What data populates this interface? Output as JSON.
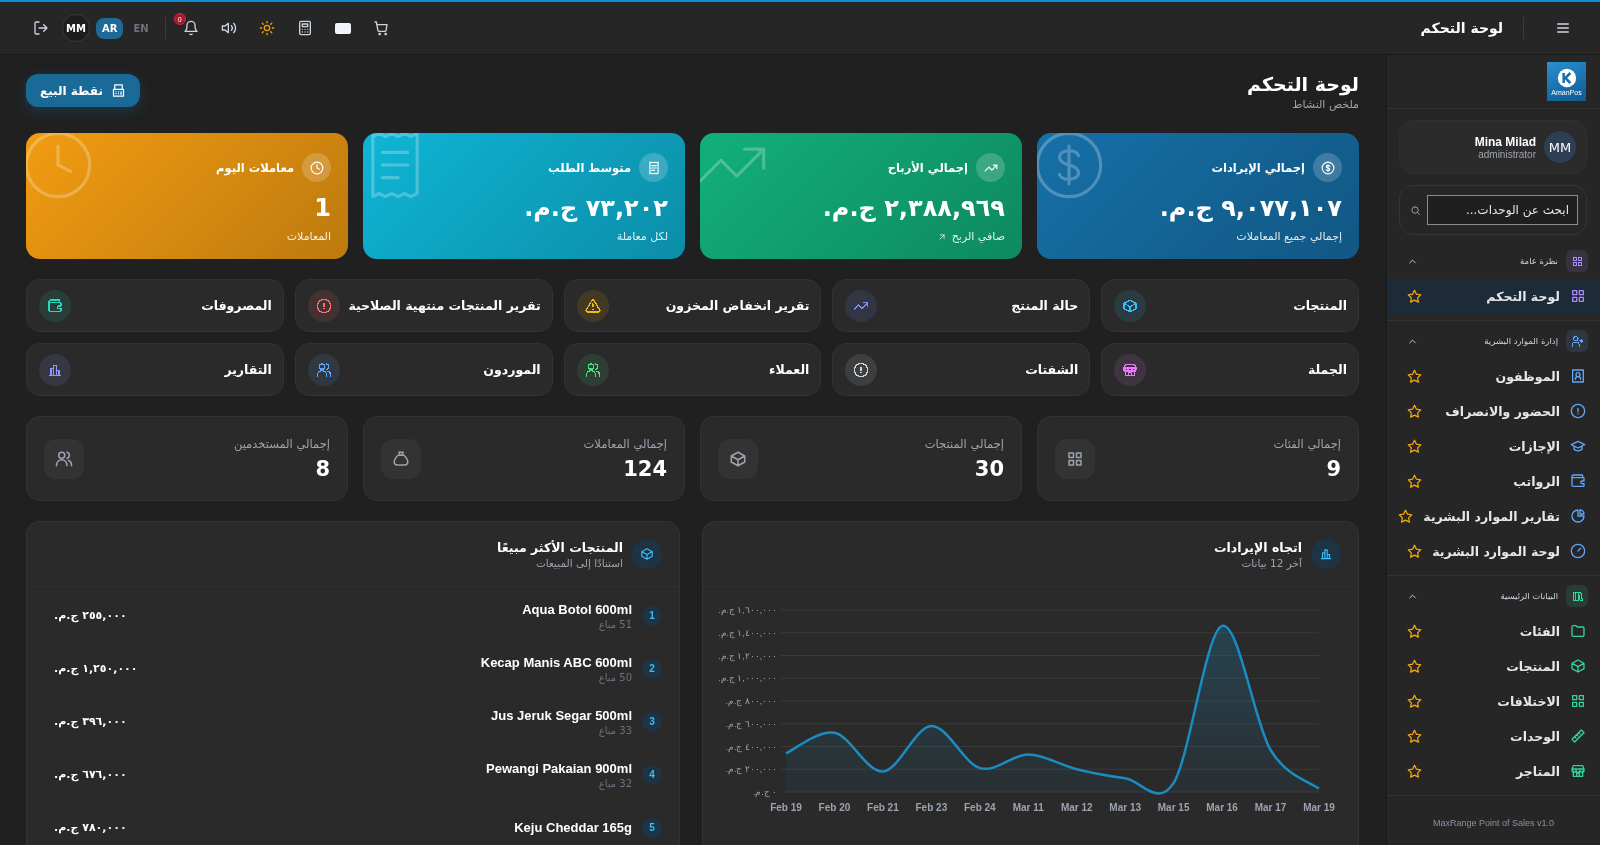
{
  "topbar": {
    "title": "لوحة التحكم",
    "user_initials": "MM",
    "languages": [
      {
        "label": "EN",
        "selected": false
      },
      {
        "label": "AR",
        "selected": true
      }
    ],
    "notification_count": "0"
  },
  "sidebar": {
    "logo_text": "AmanPos",
    "user": {
      "name": "Mina Milad",
      "role": "administrator",
      "initials": "MM"
    },
    "search": {
      "placeholder": "ابحث عن الوحدات..."
    },
    "groups": [
      {
        "title": "نظرة عامة",
        "expanded": true,
        "color": "#a78bfa",
        "items": [
          {
            "label": "لوحة التحكم",
            "selected": true
          }
        ]
      },
      {
        "title": "إدارة الموارد البشرية",
        "expanded": true,
        "color": "#60a5fa",
        "items": [
          {
            "label": "الموظفون",
            "selected": false
          },
          {
            "label": "الحضور والانصراف",
            "selected": false
          },
          {
            "label": "الإجازات",
            "selected": false
          },
          {
            "label": "الرواتب",
            "selected": false
          },
          {
            "label": "تقارير الموارد البشرية",
            "selected": false
          },
          {
            "label": "لوحة الموارد البشرية",
            "selected": false
          }
        ]
      },
      {
        "title": "البيانات الرئيسية",
        "expanded": true,
        "color": "#34d399",
        "items": [
          {
            "label": "الفئات",
            "selected": false
          },
          {
            "label": "المنتجات",
            "selected": false
          },
          {
            "label": "الاختلافات",
            "selected": false
          },
          {
            "label": "الوحدات",
            "selected": false
          },
          {
            "label": "المتاجر",
            "selected": false
          }
        ]
      }
    ],
    "footer": "MaxRange Point of Sales v1.0"
  },
  "page": {
    "title": "لوحة التحكم",
    "subtitle": "ملخص النشاط",
    "pos_button": "نقطة البيع"
  },
  "stat_cards": [
    {
      "label": "إجمالي الإيرادات",
      "value": "٩,٠٧٧,١٠٧ ج.م.",
      "note": "إجمالي جميع المعاملات",
      "color": "#1670a8"
    },
    {
      "label": "إجمالي الأرباح",
      "value": "٢,٣٨٨,٩٦٩ ج.م.",
      "note": "صافي الربح",
      "color": "#12b07a"
    },
    {
      "label": "متوسط الطلب",
      "value": "٧٣,٢٠٢ ج.م.",
      "note": "لكل معاملة",
      "color": "#0fb5d6"
    },
    {
      "label": "معاملات اليوم",
      "value": "1",
      "note": "المعاملات",
      "color": "#f29c12"
    }
  ],
  "quick_links": [
    {
      "label": "المنتجات",
      "color": "#38bdf8"
    },
    {
      "label": "حالة المنتج",
      "color": "#818cf8"
    },
    {
      "label": "تقرير انخفاض المخزون",
      "color": "#f5b50b"
    },
    {
      "label": "تقرير المنتجات منتهية الصلاحية",
      "color": "#f87171"
    },
    {
      "label": "المصروفات",
      "color": "#2dd4bf"
    },
    {
      "label": "الجملة",
      "color": "#e879f9"
    },
    {
      "label": "الشفتات",
      "color": "#d1d5db"
    },
    {
      "label": "العملاء",
      "color": "#4ade80"
    },
    {
      "label": "الموردون",
      "color": "#60a5fa"
    },
    {
      "label": "التقارير",
      "color": "#8b9cf8"
    }
  ],
  "counts": [
    {
      "label": "إجمالي الفئات",
      "value": "9"
    },
    {
      "label": "إجمالي المنتجات",
      "value": "30"
    },
    {
      "label": "إجمالي المعاملات",
      "value": "124"
    },
    {
      "label": "إجمالي المستخدمين",
      "value": "8"
    }
  ],
  "revenue_trend": {
    "title": "اتجاه الإيرادات",
    "subtitle": "آخر 12 بيانات",
    "chart_data": {
      "type": "area",
      "categories": [
        "Feb 19",
        "Feb 20",
        "Feb 21",
        "Feb 23",
        "Feb 24",
        "Mar 11",
        "Mar 12",
        "Mar 13",
        "Mar 15",
        "Mar 16",
        "Mar 17",
        "Mar 19"
      ],
      "series": [
        {
          "color": "#1a8cc2",
          "values": [
            340000,
            520000,
            180000,
            580000,
            210000,
            330000,
            200000,
            120000,
            80000,
            1460000,
            370000,
            30000
          ]
        }
      ],
      "grid": true,
      "ylim": [
        0,
        1600000
      ],
      "yticks": [
        {
          "value": 0,
          "label": "٠ ج.م."
        },
        {
          "value": 200000,
          "label": "٢٠٠,٠٠٠ ج.م."
        },
        {
          "value": 400000,
          "label": "٤٠٠,٠٠٠ ج.م."
        },
        {
          "value": 600000,
          "label": "٦٠٠,٠٠٠ ج.م."
        },
        {
          "value": 800000,
          "label": "٨٠٠,٠٠٠ ج.م."
        },
        {
          "value": 1000000,
          "label": "١,٠٠٠,٠٠٠ ج.م."
        },
        {
          "value": 1200000,
          "label": "١,٢٠٠,٠٠٠ ج.م."
        },
        {
          "value": 1400000,
          "label": "١,٤٠٠,٠٠٠ ج.م."
        },
        {
          "value": 1600000,
          "label": "١,٦٠٠,٠٠٠ ج.م."
        }
      ]
    }
  },
  "top_products": {
    "title": "المنتجات الأكثر مبيعًا",
    "subtitle": "استنادًا إلى المبيعات",
    "items": [
      {
        "rank": "1",
        "name": "Aqua Botol 600ml",
        "sold": "51 مباع",
        "amount": "٢٥٥,٠٠٠ ج.م."
      },
      {
        "rank": "2",
        "name": "Kecap Manis ABC 600ml",
        "sold": "50 مباع",
        "amount": "١,٢٥٠,٠٠٠ ج.م."
      },
      {
        "rank": "3",
        "name": "Jus Jeruk Segar 500ml",
        "sold": "33 مباع",
        "amount": "٣٩٦,٠٠٠ ج.م."
      },
      {
        "rank": "4",
        "name": "Pewangi Pakaian 900ml",
        "sold": "32 مباع",
        "amount": "٦٧٦,٠٠٠ ج.م."
      },
      {
        "rank": "5",
        "name": "Keju Cheddar 165g",
        "amount": "٧٨٠,٠٠٠ ج.م."
      }
    ]
  }
}
